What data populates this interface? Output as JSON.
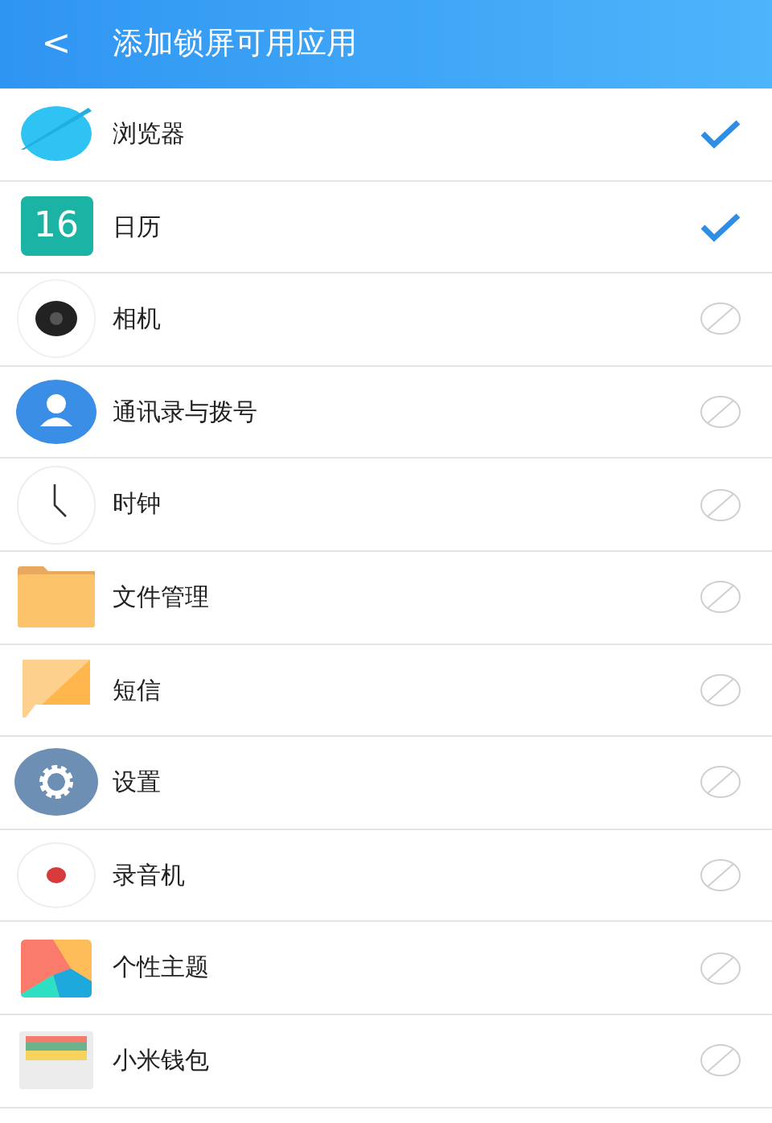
{
  "header": {
    "back": "<",
    "title": "添加锁屏可用应用"
  },
  "apps": [
    {
      "name": "浏览器",
      "checked": true
    },
    {
      "name": "日历",
      "checked": true,
      "icon_text": "16"
    },
    {
      "name": "相机",
      "checked": false
    },
    {
      "name": "通讯录与拨号",
      "checked": false
    },
    {
      "name": "时钟",
      "checked": false
    },
    {
      "name": "文件管理",
      "checked": false
    },
    {
      "name": "短信",
      "checked": false
    },
    {
      "name": "设置",
      "checked": false
    },
    {
      "name": "录音机",
      "checked": false
    },
    {
      "name": "个性主题",
      "checked": false
    },
    {
      "name": "小米钱包",
      "checked": false
    }
  ]
}
